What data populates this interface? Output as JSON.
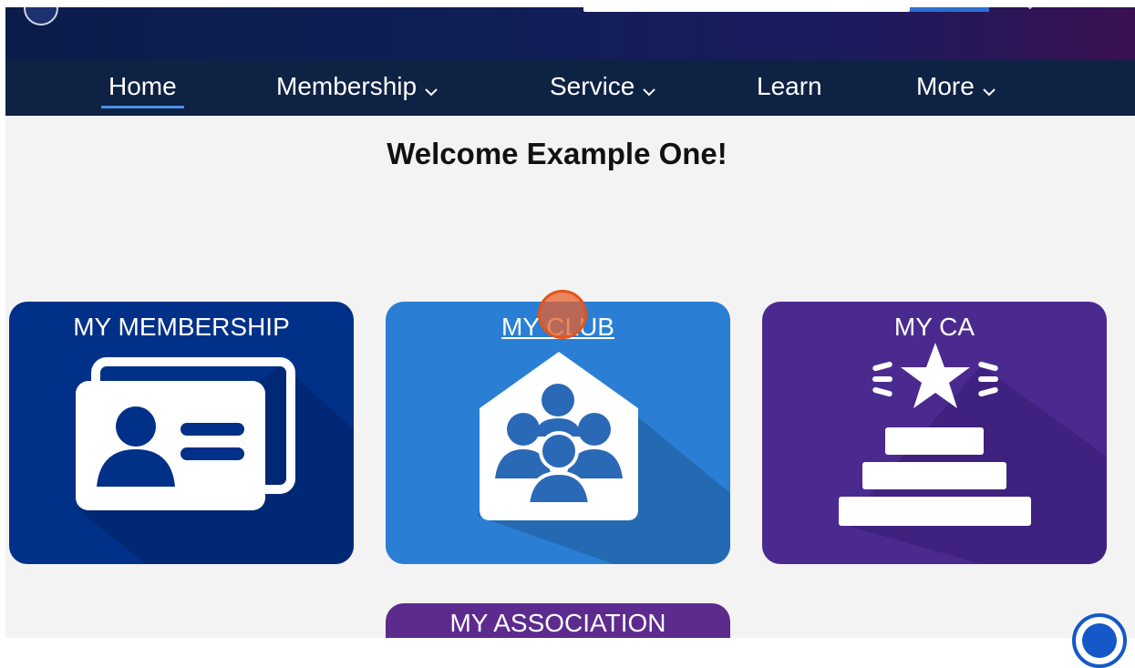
{
  "nav": {
    "items": [
      {
        "label": "Home",
        "has_dropdown": false,
        "active": true
      },
      {
        "label": "Membership",
        "has_dropdown": true,
        "active": false
      },
      {
        "label": "Service",
        "has_dropdown": true,
        "active": false
      },
      {
        "label": "Learn",
        "has_dropdown": false,
        "active": false
      },
      {
        "label": "More",
        "has_dropdown": true,
        "active": false
      }
    ],
    "active_underline_color": "#4a90e2"
  },
  "welcome": "Welcome Example One!",
  "tiles": [
    {
      "label": "MY MEMBERSHIP",
      "icon": "membership-card-icon",
      "color": "#003087"
    },
    {
      "label": "MY CLUB",
      "icon": "club-house-icon",
      "color": "#2a7fd4"
    },
    {
      "label": "MY CA",
      "icon": "achievement-star-icon",
      "color": "#4b2a90"
    },
    {
      "label": "MY ASSOCIATION",
      "icon": "association-icon",
      "color": "#5d2a8e"
    }
  ],
  "colors": {
    "banner": "#0f1f55",
    "nav_bg": "#0e2244",
    "page_bg": "#f3f3f3",
    "click_indicator": "#e3541c",
    "help_button": "#1558c7"
  },
  "icons": {
    "logo": "club-logo-icon",
    "dropdown": "chevron-down-icon",
    "help": "help-icon"
  }
}
